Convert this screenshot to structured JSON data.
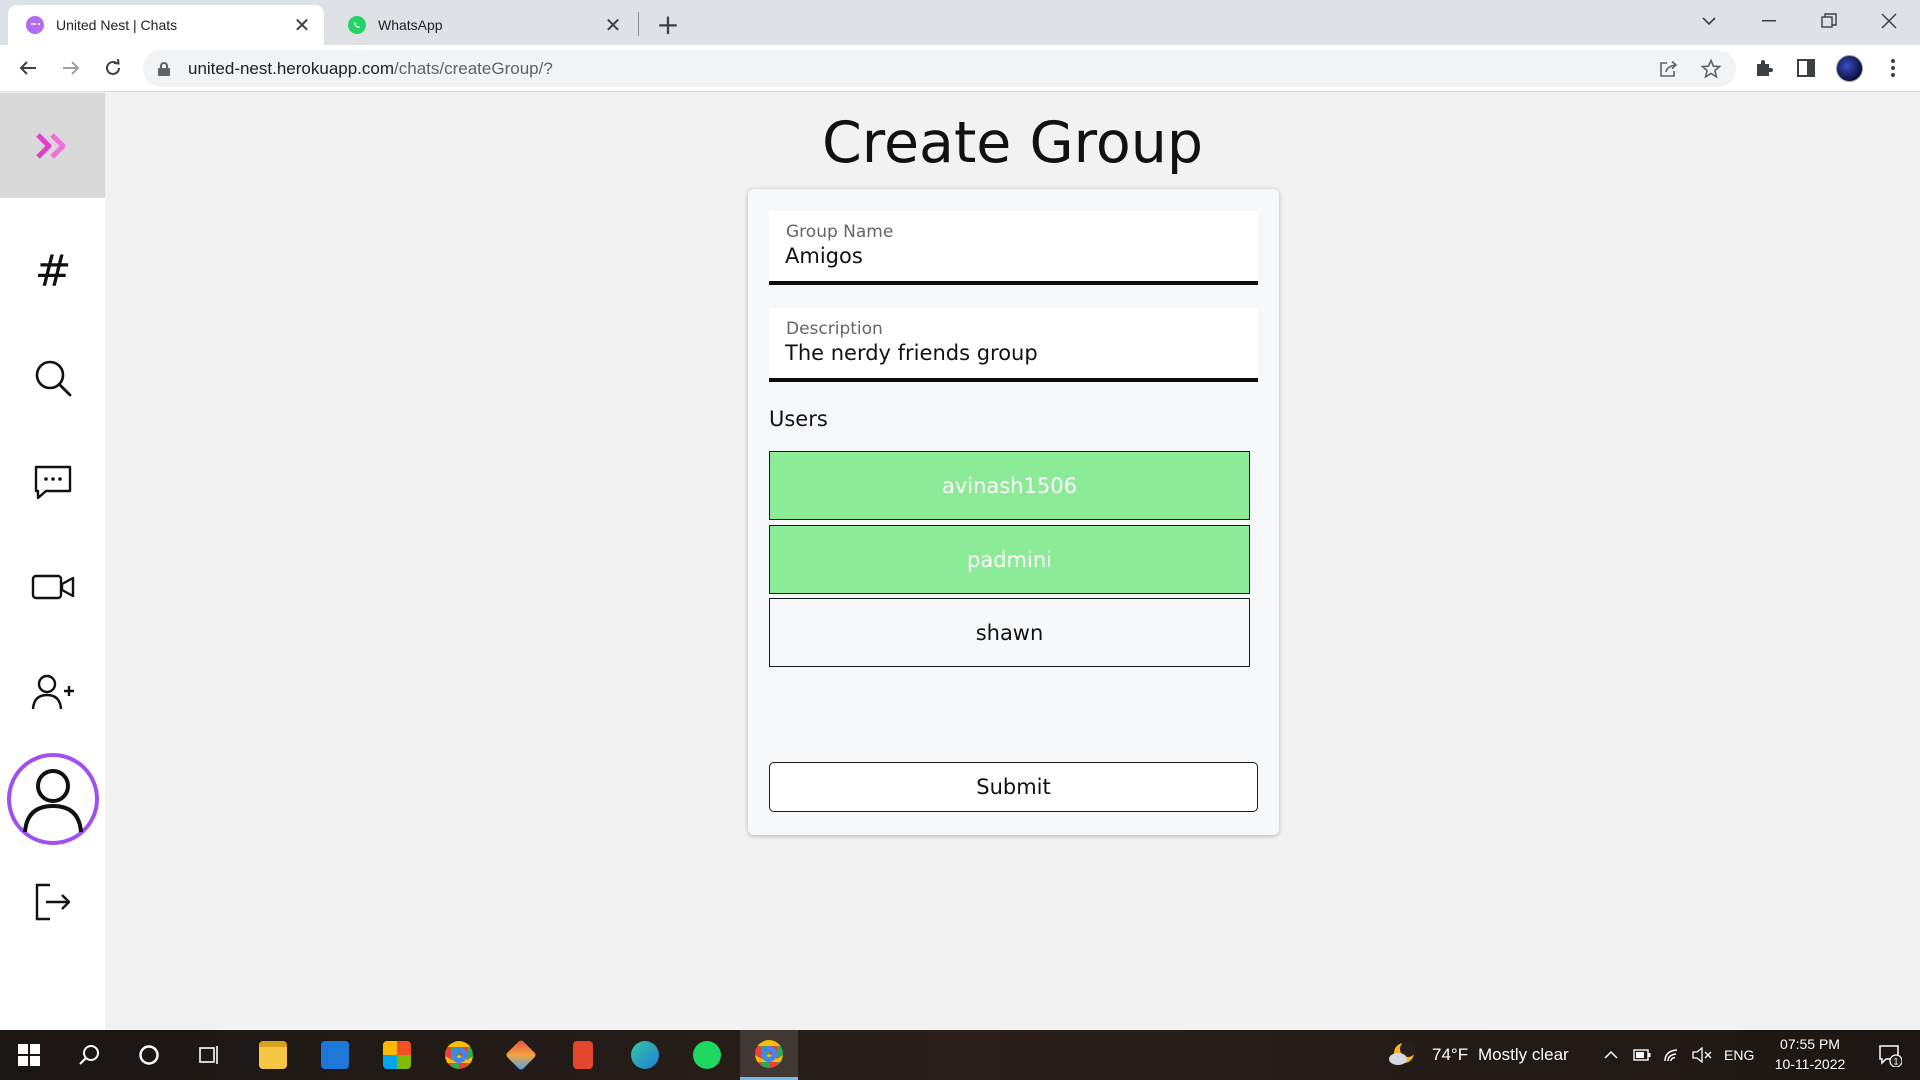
{
  "browser": {
    "tabs": [
      {
        "title": "United Nest | Chats",
        "active": true,
        "favicon": "united-nest-favicon"
      },
      {
        "title": "WhatsApp",
        "active": false,
        "favicon": "whatsapp-favicon"
      }
    ],
    "url_host": "united-nest.herokuapp.com",
    "url_path": "/chats/createGroup/?"
  },
  "sidebar": {
    "items": [
      {
        "name": "logo",
        "icon": "double-chevron-right-icon"
      },
      {
        "name": "channels",
        "icon": "hash-icon",
        "glyph": "#"
      },
      {
        "name": "search",
        "icon": "search-icon"
      },
      {
        "name": "chats",
        "icon": "chat-bubble-icon"
      },
      {
        "name": "video-call",
        "icon": "video-camera-icon"
      },
      {
        "name": "add-friend",
        "icon": "add-user-icon"
      },
      {
        "name": "profile",
        "icon": "user-avatar-icon"
      },
      {
        "name": "logout",
        "icon": "logout-icon"
      }
    ],
    "accent_color": "#e040c8",
    "avatar_ring_color": "#a050f0"
  },
  "main": {
    "title": "Create Group",
    "form": {
      "group_name": {
        "label": "Group Name",
        "value": "Amigos"
      },
      "description": {
        "label": "Description",
        "value": "The nerdy friends group"
      },
      "users_label": "Users",
      "users": [
        {
          "name": "avinash1506",
          "selected": true
        },
        {
          "name": "padmini",
          "selected": true
        },
        {
          "name": "shawn",
          "selected": false
        }
      ],
      "submit_label": "Submit",
      "selected_color": "#8ceb96"
    }
  },
  "taskbar": {
    "weather_temp": "74°F",
    "weather_text": "Mostly clear",
    "language": "ENG",
    "time": "07:55 PM",
    "date": "10-11-2022",
    "notification_count": "1"
  }
}
